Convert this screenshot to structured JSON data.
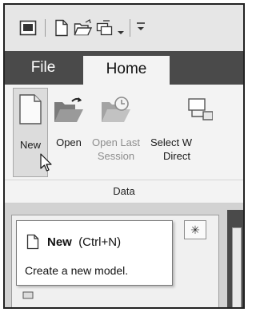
{
  "tabs": {
    "file": "File",
    "home": "Home"
  },
  "ribbon": {
    "buttons": {
      "new": "New",
      "open": "Open",
      "open_last": "Open Last",
      "open_last_2": "Session",
      "select_wd": "Select W",
      "select_wd_2": "Direct"
    },
    "group_label": "Data"
  },
  "tooltip": {
    "title": "New",
    "shortcut": "(Ctrl+N)",
    "description": "Create a new model."
  },
  "colors": {
    "tab_strip": "#4a4a4a",
    "ribbon_bg": "#f3f3f3",
    "folder": "#6e6e6e"
  },
  "icons": [
    "app-menu-icon",
    "new-file-icon",
    "open-folder-icon",
    "open-last-session-icon",
    "select-working-directory-icon",
    "mouse-cursor-icon",
    "asterisk-icon"
  ]
}
